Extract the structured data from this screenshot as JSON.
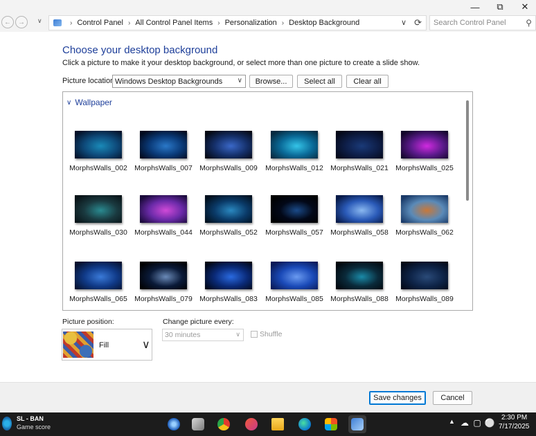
{
  "window": {
    "minimize_glyph": "—",
    "maximize_glyph": "⧉",
    "close_glyph": "✕"
  },
  "address_bar": {
    "breadcrumbs": [
      "Control Panel",
      "All Control Panel Items",
      "Personalization",
      "Desktop Background"
    ],
    "search_placeholder": "Search Control Panel"
  },
  "page": {
    "heading": "Choose your desktop background",
    "subtext": "Click a picture to make it your desktop background, or select more than one picture to create a slide show.",
    "location_label": "Picture location:",
    "location_value": "Windows Desktop Backgrounds",
    "browse_label": "Browse...",
    "select_all_label": "Select all",
    "clear_all_label": "Clear all",
    "group_label": "Wallpaper"
  },
  "wallpapers": [
    {
      "name": "MorphsWalls_002",
      "colors": [
        "#04122a",
        "#0e4a7a",
        "#1a8ab8"
      ]
    },
    {
      "name": "MorphsWalls_007",
      "colors": [
        "#020a1e",
        "#0a3a78",
        "#2a78c8"
      ]
    },
    {
      "name": "MorphsWalls_009",
      "colors": [
        "#050914",
        "#15306a",
        "#3a68c8"
      ]
    },
    {
      "name": "MorphsWalls_012",
      "colors": [
        "#062a40",
        "#0a6a98",
        "#34c4e8"
      ]
    },
    {
      "name": "MorphsWalls_021",
      "colors": [
        "#050818",
        "#0e1e48",
        "#1a3a78"
      ]
    },
    {
      "name": "MorphsWalls_025",
      "colors": [
        "#12062a",
        "#5a1a8a",
        "#d02ae0"
      ]
    },
    {
      "name": "MorphsWalls_030",
      "colors": [
        "#0a1418",
        "#1a3a40",
        "#2a8a90"
      ]
    },
    {
      "name": "MorphsWalls_044",
      "colors": [
        "#1a0a3a",
        "#6a2aa8",
        "#d04ad8"
      ]
    },
    {
      "name": "MorphsWalls_052",
      "colors": [
        "#02101e",
        "#0a3a68",
        "#2a88c0"
      ]
    },
    {
      "name": "MorphsWalls_057",
      "colors": [
        "#000000",
        "#020818",
        "#1a4a88"
      ]
    },
    {
      "name": "MorphsWalls_058",
      "colors": [
        "#081a48",
        "#2a5ab8",
        "#8ab8f0"
      ]
    },
    {
      "name": "MorphsWalls_062",
      "colors": [
        "#1a3a68",
        "#5a8ab8",
        "#c8783a"
      ]
    },
    {
      "name": "MorphsWalls_065",
      "colors": [
        "#061230",
        "#103a88",
        "#3a7ad8"
      ]
    },
    {
      "name": "MorphsWalls_079",
      "colors": [
        "#000000",
        "#0a1a38",
        "#6a8ab8"
      ]
    },
    {
      "name": "MorphsWalls_083",
      "colors": [
        "#020818",
        "#0a2a78",
        "#2a6ae0"
      ]
    },
    {
      "name": "MorphsWalls_085",
      "colors": [
        "#0a1a58",
        "#1a4ab8",
        "#6a9af0"
      ]
    },
    {
      "name": "MorphsWalls_088",
      "colors": [
        "#02080e",
        "#0a2a3a",
        "#1a8aa8"
      ]
    },
    {
      "name": "MorphsWalls_089",
      "colors": [
        "#040a18",
        "#0e2448",
        "#2a4a78"
      ]
    }
  ],
  "options": {
    "position_label": "Picture position:",
    "position_value": "Fill",
    "change_label": "Change picture every:",
    "change_value": "30 minutes",
    "shuffle_label": "Shuffle"
  },
  "footer": {
    "save_label": "Save changes",
    "cancel_label": "Cancel"
  },
  "taskbar": {
    "score_title": "SL - BAN",
    "score_sub": "Game score",
    "time": "2:30 PM",
    "date": "7/17/2025"
  },
  "colors": {
    "heading_blue": "#1e3f9a",
    "accent": "#0078d4",
    "taskbar": "#1c1c1c"
  }
}
